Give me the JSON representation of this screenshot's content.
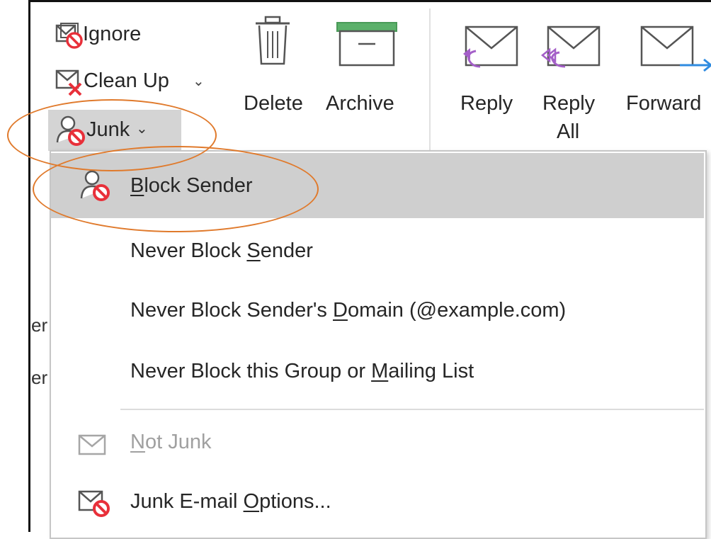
{
  "ribbon": {
    "ignore_label": "Ignore",
    "cleanup_label": "Clean Up",
    "junk_label": "Junk",
    "delete_label": "Delete",
    "archive_label": "Archive",
    "reply_label": "Reply",
    "reply_all_line1": "Reply",
    "reply_all_line2": "All",
    "forward_label": "Forward"
  },
  "junk_menu": {
    "items": [
      {
        "pre": "",
        "mnemonic": "B",
        "post": "lock Sender"
      },
      {
        "pre": "Never Block ",
        "mnemonic": "S",
        "post": "ender"
      },
      {
        "pre": "Never Block Sender's ",
        "mnemonic": "D",
        "post": "omain (@example.com)"
      },
      {
        "pre": "Never Block this Group or ",
        "mnemonic": "M",
        "post": "ailing List"
      },
      {
        "pre": "",
        "mnemonic": "N",
        "post": "ot Junk"
      },
      {
        "pre": "Junk E-mail ",
        "mnemonic": "O",
        "post": "ptions..."
      }
    ]
  },
  "background_fragments": [
    "er",
    "er"
  ],
  "colors": {
    "annotation": "#e07a2c",
    "block_red": "#e8303a",
    "archive_green": "#5bb06a",
    "reply_purple": "#a45fc8",
    "forward_blue": "#2f8be0",
    "hover_gray": "#cfcfcf"
  },
  "icons": [
    "ignore-icon",
    "cleanup-icon",
    "junk-icon",
    "delete-icon",
    "archive-icon",
    "reply-icon",
    "reply-all-icon",
    "forward-icon",
    "block-sender-icon",
    "not-junk-icon",
    "junk-options-icon"
  ]
}
